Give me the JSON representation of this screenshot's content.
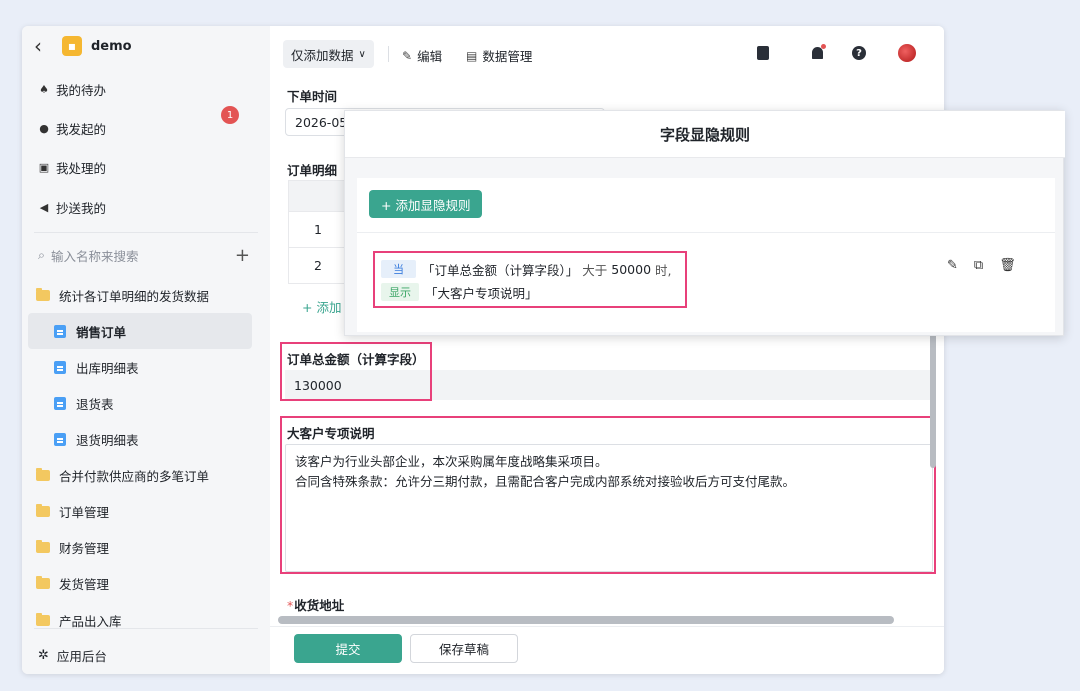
{
  "app": {
    "name": "demo"
  },
  "sidebar": {
    "nav": [
      {
        "label": "我的待办",
        "icon": "bell-icon",
        "badge": "1"
      },
      {
        "label": "我发起的",
        "icon": "play-circle-icon"
      },
      {
        "label": "我处理的",
        "icon": "inbox-icon"
      },
      {
        "label": "抄送我的",
        "icon": "send-icon"
      }
    ],
    "search_placeholder": "输入名称来搜索",
    "tree": [
      {
        "label": "统计各订单明细的发货数据",
        "type": "folder"
      },
      {
        "label": "销售订单",
        "type": "doc",
        "active": true
      },
      {
        "label": "出库明细表",
        "type": "doc"
      },
      {
        "label": "退货表",
        "type": "doc"
      },
      {
        "label": "退货明细表",
        "type": "doc"
      },
      {
        "label": "合并付款供应商的多笔订单",
        "type": "folder"
      },
      {
        "label": "订单管理",
        "type": "folder"
      },
      {
        "label": "财务管理",
        "type": "folder"
      },
      {
        "label": "发货管理",
        "type": "folder"
      },
      {
        "label": "产品出入库",
        "type": "folder"
      }
    ],
    "bottom": {
      "label": "应用后台",
      "icon": "gear-icon"
    }
  },
  "toolbar": {
    "mode": "仅添加数据",
    "edit": "编辑",
    "data_manage": "数据管理"
  },
  "form": {
    "order_time_label": "下单时间",
    "order_time_value": "2026-05",
    "order_detail_label": "订单明细",
    "rows": [
      "1",
      "2"
    ],
    "add_row": "+ 添加",
    "total_label": "订单总金额（计算字段）",
    "total_value": "130000",
    "vip_label": "大客户专项说明",
    "vip_text_1": "该客户为行业头部企业，本次采购属年度战略集采项目。",
    "vip_text_2": "合同含特殊条款：允许分三期付款，且需配合客户完成内部系统对接验收后方可支付尾款。",
    "address_label": "收货地址",
    "required_mark": "*"
  },
  "footer": {
    "submit": "提交",
    "save_draft": "保存草稿"
  },
  "popup": {
    "title": "字段显隐规则",
    "add_rule": "+ 添加显隐规则",
    "rule": {
      "when_tag": "当",
      "when_field": "「订单总金额（计算字段）」",
      "when_op": "大于",
      "when_value": "50000",
      "when_suffix": "时,",
      "show_tag": "显示",
      "show_field": "「大客户专项说明」"
    }
  },
  "colors": {
    "primary": "#3aa58f",
    "highlight": "#e8407a",
    "badge": "#e35454"
  }
}
